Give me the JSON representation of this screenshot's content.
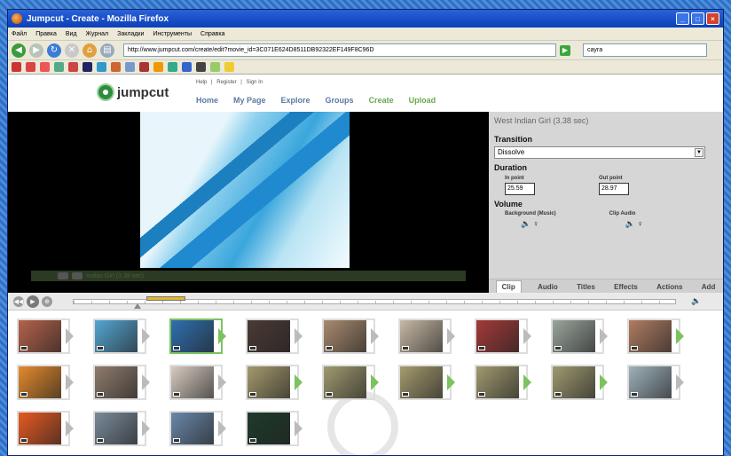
{
  "window": {
    "title": "Jumpcut - Create - Mozilla Firefox",
    "menu": [
      "Файл",
      "Правка",
      "Вид",
      "Журнал",
      "Закладки",
      "Инструменты",
      "Справка"
    ],
    "url": "http://www.jumpcut.com/create/edit?movie_id=3C071E624D8511DB92322EF149F8C96D",
    "search_value": "cayra"
  },
  "site": {
    "logo_text": "jumpcut",
    "top_links": [
      "Help",
      "|",
      "Register",
      "|",
      "Sign In"
    ],
    "nav": [
      "Home",
      "My Page",
      "Explore",
      "Groups",
      "Create",
      "Upload"
    ],
    "nav_active": [
      "Create",
      "Upload"
    ]
  },
  "editor": {
    "clip_title": "West Indian Girl (3.38 sec)",
    "player_caption": "Indian Girl (3.38 sec)",
    "transition_label": "Transition",
    "transition_value": "Dissolve",
    "duration_label": "Duration",
    "in_point_label": "In point",
    "in_point_value": "25.59",
    "out_point_label": "Out point",
    "out_point_value": "28.97",
    "volume_label": "Volume",
    "bg_music_label": "Background (Music)",
    "clip_audio_label": "Clip Audio",
    "tabs": [
      "Clip",
      "Audio",
      "Titles",
      "Effects",
      "Actions",
      "Add"
    ],
    "active_tab": "Clip"
  },
  "timeline": {
    "selection_start_fraction": 0.12,
    "selection_width_fraction": 0.065
  },
  "library": {
    "thumbnail_colors": [
      [
        "#b5624a",
        "#55a6d3",
        "#2f6fb0",
        "#4a3a34",
        "#a88b6f",
        "#c7b9a5",
        "#a33a38",
        "#9aa59c",
        "#b07c62"
      ],
      [
        "#e48a2c",
        "#8f7c6d",
        "#d7cbc0",
        "#a49a6d",
        "#a09a70",
        "#a49b6e",
        "#a09a6f",
        "#9f9a70",
        "#9eb1bb"
      ],
      [
        "#e85a22",
        "#7a8a9a",
        "#6a87a8",
        "#1d3b2a"
      ]
    ],
    "selected_thumbnail": [
      0,
      2
    ],
    "green_tab_thumbnails": [
      [
        0,
        2
      ],
      [
        0,
        8
      ],
      [
        1,
        3
      ],
      [
        1,
        4
      ],
      [
        1,
        5
      ],
      [
        1,
        6
      ],
      [
        1,
        7
      ]
    ]
  }
}
